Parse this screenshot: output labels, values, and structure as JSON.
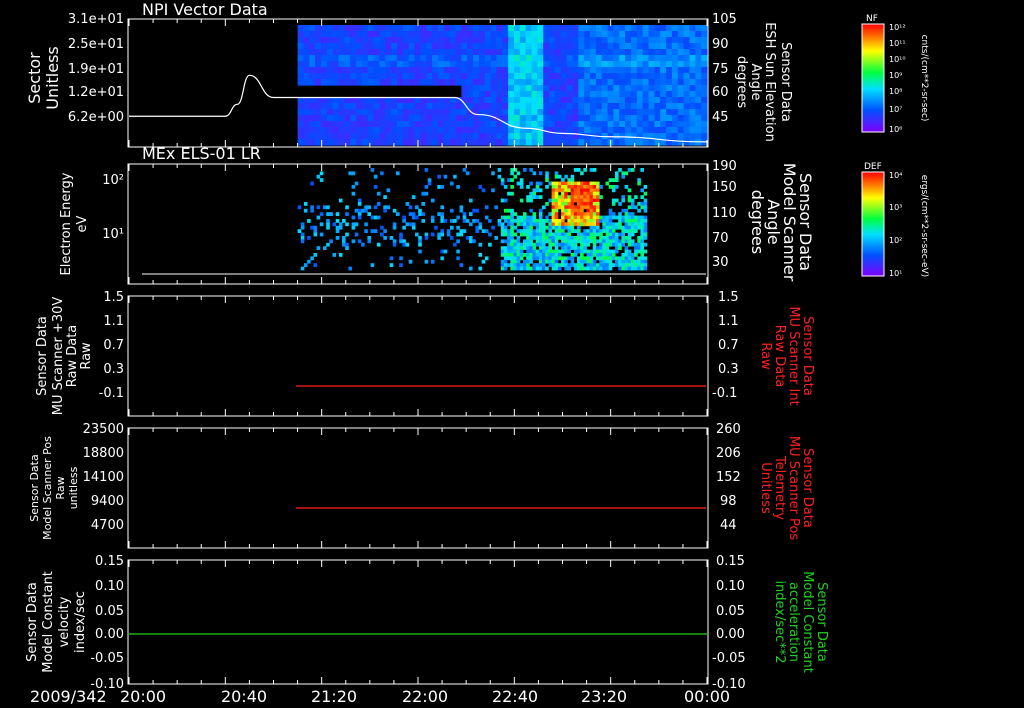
{
  "date_label": "2009/342",
  "x_ticks": [
    "20:00",
    "20:40",
    "21:20",
    "22:00",
    "22:40",
    "23:20",
    "00:00"
  ],
  "panels": {
    "p1": {
      "title": "NPI Vector Data",
      "ylabel_left": [
        "Sector",
        "Unitless"
      ],
      "yticks_left": [
        "3.1e+01",
        "2.5e+01",
        "1.9e+01",
        "1.2e+01",
        "6.2e+00"
      ],
      "ylabel_right": [
        "Sensor Data",
        "ESH Sun Elevation",
        "Angle",
        "degrees"
      ],
      "yticks_right": [
        "105",
        "90",
        "75",
        "60",
        "45"
      ],
      "colorbar": {
        "tag": "NF",
        "top": "10¹²",
        "ticks": [
          "10¹¹",
          "10¹⁰",
          "10⁹",
          "10⁸",
          "10⁷"
        ],
        "bottom": "10⁶",
        "unit": "cnts/(cm**2-sr-sec)"
      }
    },
    "p2": {
      "title": "MEx ELS-01 LR",
      "ylabel_left": [
        "Electron Energy",
        "eV"
      ],
      "yticks_left": [
        "10²",
        "10¹"
      ],
      "ylabel_right": [
        "Sensor Data",
        "Model Scanner",
        "Angle",
        "degrees"
      ],
      "yticks_right": [
        "190",
        "150",
        "110",
        "70",
        "30"
      ],
      "colorbar": {
        "tag": "DEF",
        "top": "10⁴",
        "ticks": [
          "10³",
          "10²"
        ],
        "bottom": "10¹",
        "unit": "ergs/(cm**2-sr-sec-eV)"
      }
    },
    "p3": {
      "ylabel_left": [
        "Sensor Data",
        "MU Scanner +30V",
        "Raw Data",
        "Raw"
      ],
      "yticks_left": [
        "1.5",
        "1.1",
        "0.7",
        "0.3",
        "-0.1"
      ],
      "ylabel_right": [
        "Sensor Data",
        "MU Scanner Int",
        "Raw Data",
        "Raw"
      ],
      "yticks_right": [
        "1.5",
        "1.1",
        "0.7",
        "0.3",
        "-0.1"
      ]
    },
    "p4": {
      "ylabel_left": [
        "Sensor Data",
        "Model Scanner Pos",
        "Raw",
        "unitless"
      ],
      "yticks_left": [
        "23500",
        "18800",
        "14100",
        "9400",
        "4700"
      ],
      "ylabel_right": [
        "Sensor Data",
        "MU Scanner Pos",
        "Telemetry",
        "Unitless"
      ],
      "yticks_right": [
        "260",
        "206",
        "152",
        "98",
        "44"
      ]
    },
    "p5": {
      "ylabel_left": [
        "Sensor Data",
        "Model Constant",
        "velocity",
        "index/sec"
      ],
      "yticks_left": [
        "0.15",
        "0.10",
        "0.05",
        "0.00",
        "-0.05",
        "-0.10"
      ],
      "ylabel_right": [
        "Sensor Data",
        "Model Constant",
        "acceleration",
        "index/sec**2"
      ],
      "yticks_right": [
        "0.15",
        "0.10",
        "0.05",
        "0.00",
        "-0.05",
        "-0.10"
      ]
    }
  },
  "colors": {
    "red_line": "#ff2020",
    "green_line": "#20d020",
    "right_label_p3": "#ff2020",
    "right_label_p4": "#ff2020",
    "right_label_p5": "#20d020"
  },
  "chart_data": [
    {
      "type": "line",
      "title": "NPI Vector Data",
      "xlabel": "2009/342",
      "x_range": [
        "20:00",
        "00:00"
      ],
      "ylabel": "Sensor Data ESH Sun Elevation Angle degrees",
      "ylim": [
        30,
        105
      ],
      "series": [
        {
          "name": "",
          "x": [
            "20:00",
            "20:40",
            "20:45",
            "20:50",
            "21:00",
            "21:45",
            "22:15",
            "22:25",
            "22:45",
            "23:00",
            "23:20",
            "00:00"
          ],
          "values": [
            48,
            48,
            55,
            72,
            59,
            59,
            59,
            49,
            41,
            38,
            36,
            33
          ]
        }
      ]
    },
    {
      "type": "heatmap",
      "title": "MEx ELS-01 LR",
      "ylabel": "Electron Energy eV",
      "y_scale": "log",
      "colorbar": "DEF ergs/(cm**2-sr-sec-eV)",
      "x_range": [
        "21:10",
        "23:35"
      ]
    },
    {
      "type": "line",
      "ylabel": "Sensor Data MU Scanner Int Raw Data Raw",
      "ylim": [
        -0.3,
        1.5
      ],
      "series": [
        {
          "name": "",
          "x": [
            "21:10",
            "00:00"
          ],
          "values": [
            0.0,
            0.0
          ]
        }
      ]
    },
    {
      "type": "line",
      "ylabel": "Sensor Data MU Scanner Pos Telemetry Unitless",
      "ylim": [
        17,
        260
      ],
      "series": [
        {
          "name": "",
          "x": [
            "21:10",
            "00:00"
          ],
          "values": [
            98,
            98
          ]
        }
      ]
    },
    {
      "type": "line",
      "ylabel": "Sensor Data Model Constant velocity index/sec",
      "ylim": [
        -0.1,
        0.15
      ],
      "series": [
        {
          "name": "",
          "x": [
            "20:00",
            "00:00"
          ],
          "values": [
            0.0,
            0.0
          ]
        }
      ]
    }
  ]
}
